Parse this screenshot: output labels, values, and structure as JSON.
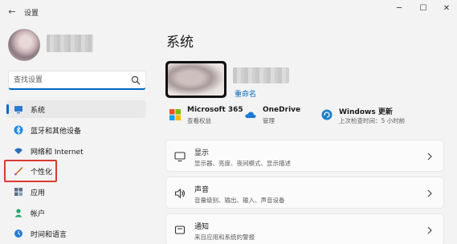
{
  "window": {
    "title": "设置",
    "controls": {
      "minimize": "─",
      "maximize": "☐",
      "close": "✕"
    }
  },
  "sidebar": {
    "search_placeholder": "查找设置",
    "items": [
      {
        "label": "系统",
        "icon": "system-icon",
        "active": true
      },
      {
        "label": "蓝牙和其他设备",
        "icon": "bluetooth-icon",
        "active": false
      },
      {
        "label": "网络和 Internet",
        "icon": "wifi-icon",
        "active": false
      },
      {
        "label": "个性化",
        "icon": "brush-icon",
        "active": false
      },
      {
        "label": "应用",
        "icon": "apps-icon",
        "active": false
      },
      {
        "label": "帐户",
        "icon": "account-icon",
        "active": false
      },
      {
        "label": "时间和语言",
        "icon": "time-language-icon",
        "active": false
      }
    ]
  },
  "main": {
    "title": "系统",
    "rename_label": "重命名",
    "services": [
      {
        "name": "Microsoft 365",
        "desc": "查看权益",
        "icon": "microsoft-icon"
      },
      {
        "name": "OneDrive",
        "desc": "管理",
        "icon": "cloud-icon"
      },
      {
        "name": "Windows 更新",
        "desc": "上次检查时间：5 小时前",
        "icon": "update-icon"
      }
    ],
    "cards": [
      {
        "title": "显示",
        "desc": "显示器、亮度、夜间模式、显示描述",
        "icon": "display-icon"
      },
      {
        "title": "声音",
        "desc": "音量级别、输出、输入、声音设备",
        "icon": "sound-icon"
      },
      {
        "title": "通知",
        "desc": "来自应用和系统的警报",
        "icon": "notification-icon"
      }
    ]
  },
  "colors": {
    "accent": "#0067c0",
    "highlight_border": "#d93a32"
  }
}
